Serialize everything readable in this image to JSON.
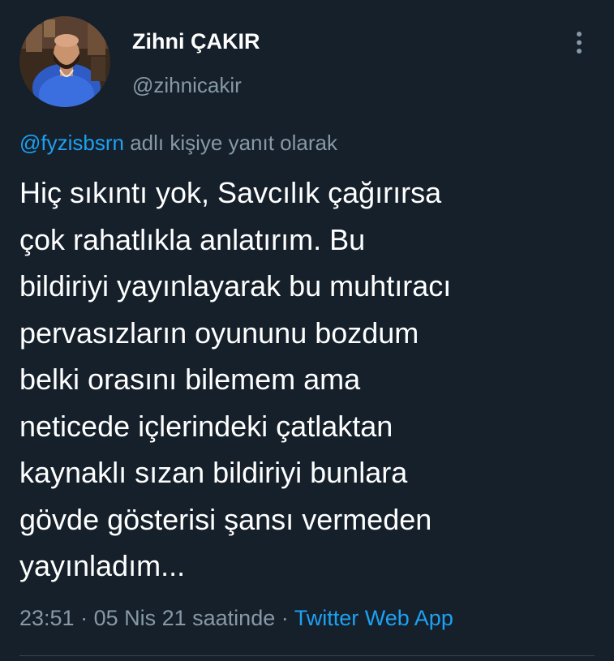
{
  "author": {
    "display_name": "Zihni ÇAKIR",
    "handle": "@zihnicakir"
  },
  "reply_to": {
    "mention": "@fyzisbsrn",
    "suffix": " adlı kişiye yanıt olarak"
  },
  "tweet": {
    "lines": [
      "Hiç sıkıntı yok, Savcılık çağırırsa",
      "çok rahatlıkla anlatırım. Bu",
      "bildiriyi yayınlayarak bu muhtıracı",
      "pervasızların oyununu bozdum",
      "belki orasını bilemem ama",
      "neticede içlerindeki çatlaktan",
      "kaynaklı sızan bildiriyi bunlara",
      "gövde gösterisi şansı vermeden",
      "yayınladım..."
    ]
  },
  "meta": {
    "time": "23:51",
    "sep1": " · ",
    "date": "05 Nis 21 saatinde",
    "sep2": " · ",
    "source": "Twitter Web App"
  },
  "icons": {
    "more": "more-vertical-icon"
  },
  "colors": {
    "background": "#15202b",
    "primary_text": "#ffffff",
    "secondary_text": "#8899a6",
    "accent": "#1da1f2",
    "divider": "#38444d"
  }
}
